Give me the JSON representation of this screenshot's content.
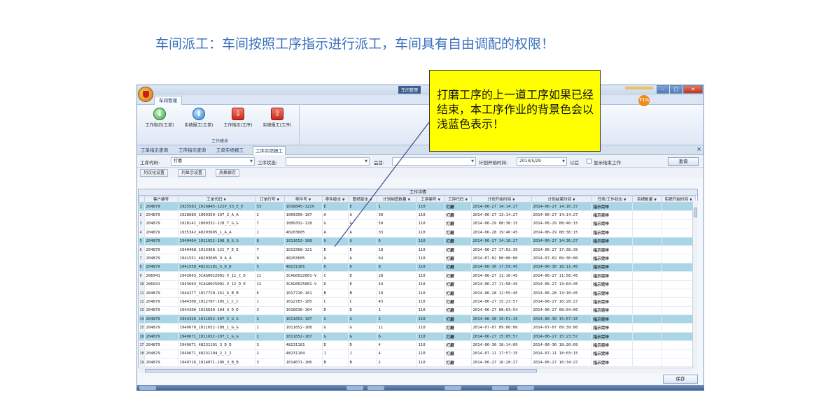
{
  "slide_title": "车间派工：车间按照工序指示进行派工，车间具有自由调配的权限！",
  "callout_text": "打磨工序的上一道工序如果已经结束，本工序作业的背景色会以浅蓝色表示！",
  "window": {
    "title": "车间管理",
    "cpu": "71%"
  },
  "ribbon": {
    "tab": "车间管理",
    "buttons": [
      "工作指示(工单)",
      "实绩报工(工单)",
      "工作指示(工序)",
      "实绩报工(工序)"
    ],
    "group_label": "工作模块"
  },
  "doc_tabs": [
    "工单指示查询",
    "工序指示查询",
    "工单实绩报工",
    "工序实绩报工"
  ],
  "filters": {
    "op_code_label": "工序代码:",
    "op_code_value": "打磨",
    "op_status_label": "工序状态:",
    "op_status_value": "",
    "item_label": "品目:",
    "item_value": "",
    "plan_start_label": "计划开始时间:",
    "plan_start_value": "2014/5/29",
    "after_label": "以后",
    "show_end_label": "显示结束工作",
    "query_button": "查询"
  },
  "toolbar": {
    "col_settings": "列汉化设置",
    "col_display": "列显示设置",
    "style_save": "风格保存"
  },
  "grid": {
    "band": "工作详情",
    "columns": [
      "客户编号",
      "工单代码",
      "订单行号",
      "零件号",
      "零件版本",
      "图纸版本",
      "计划制造数量",
      "工序编号",
      "工序代码",
      "计划开始时间",
      "计划结束时间",
      "任务/工作状态",
      "实绩数量",
      "实绩开始时间"
    ],
    "rows": [
      {
        "n": "1",
        "c": [
          "204879",
          "1925583_1016845-122V_53_E_E",
          "53",
          "1016845-122V",
          "E",
          "E",
          "1",
          "110",
          "打磨",
          "2014-06-27 14:14:27",
          "2014-06-27 14:16:27",
          "指示完毕",
          "",
          ""
        ],
        "hl": true
      },
      {
        "n": "2",
        "c": [
          "204879",
          "1928089_1009350-107_2_A_A",
          "2",
          "1009350-107",
          "A",
          "A",
          "30",
          "110",
          "打磨",
          "2014-06-27 13:14:27",
          "2014-06-27 14:14:27",
          "指示完毕",
          "",
          ""
        ],
        "hl": false
      },
      {
        "n": "3",
        "c": [
          "204879",
          "1928141_1009332-128_7_G_G",
          "7",
          "1009332-128",
          "G",
          "G",
          "50",
          "110",
          "打磨",
          "2014-06-29 08:36:15",
          "2014-06-29 08:46:15",
          "指示完毕",
          "",
          ""
        ],
        "hl": false
      },
      {
        "n": "4",
        "c": [
          "204879",
          "1935342_48203605_1_A_A",
          "1",
          "48203605",
          "A",
          "A",
          "33",
          "110",
          "打磨",
          "2014-06-28 19:46:45",
          "2014-06-29 08:36:15",
          "指示完毕",
          "",
          ""
        ],
        "hl": false
      },
      {
        "n": "5",
        "c": [
          "204879",
          "1940464_1011652-108_8_G_G",
          "8",
          "1011652-108",
          "G",
          "G",
          "6",
          "110",
          "打磨",
          "2014-06-27 14:18:27",
          "2014-06-27 14:36:27",
          "指示完毕",
          "",
          ""
        ],
        "hl": true
      },
      {
        "n": "6",
        "c": [
          "204879",
          "1940468_1013368-121_7_E_E",
          "7",
          "1013368-121",
          "E",
          "E",
          "18",
          "110",
          "打磨",
          "2014-06-27 17:02:39",
          "2014-06-27 17:38:39",
          "指示完毕",
          "",
          ""
        ],
        "hl": false
      },
      {
        "n": "7",
        "c": [
          "204879",
          "1941551_48203605_9_A_A",
          "9",
          "48203605",
          "A",
          "A",
          "64",
          "110",
          "打磨",
          "2014-07-02 08:00:00",
          "2014-07-02 09:36:00",
          "指示完毕",
          "",
          ""
        ],
        "hl": false
      },
      {
        "n": "8",
        "c": [
          "204879",
          "1941558_48231101_5_D_D",
          "5",
          "48231101",
          "D",
          "D",
          "8",
          "110",
          "打磨",
          "2014-06-30 17:59:45",
          "2014-06-30 18:11:45",
          "指示完毕",
          "",
          ""
        ],
        "hl": true
      },
      {
        "n": "9",
        "c": [
          "206941",
          "1943663_3CAG0022001-V_11_C_D",
          "11",
          "3CAG0022001-V",
          "C",
          "D",
          "28",
          "110",
          "打磨",
          "2014-06-27 11:16:45",
          "2014-06-27 11:58:45",
          "指示完毕",
          "",
          ""
        ],
        "hl": false
      },
      {
        "n": "10",
        "c": [
          "206941",
          "1943663_3CAG0025001-V_12_D_E",
          "12",
          "3CAG0025001-V",
          "D",
          "E",
          "44",
          "110",
          "打磨",
          "2014-06-27 11:58:45",
          "2014-06-27 13:04:45",
          "指示完毕",
          "",
          ""
        ],
        "hl": false
      },
      {
        "n": "11",
        "c": [
          "204879",
          "1944277_1017720-161_6_B_B",
          "6",
          "1017720-161",
          "B",
          "B",
          "10",
          "110",
          "打磨",
          "2014-06-28 12:55:45",
          "2014-06-28 13:10:45",
          "指示完毕",
          "",
          ""
        ],
        "hl": false
      },
      {
        "n": "12",
        "c": [
          "204879",
          "1944300_1012787-105_1_C_C",
          "1",
          "1012787-105",
          "C",
          "C",
          "43",
          "110",
          "打磨",
          "2014-06-27 15:23:57",
          "2014-06-27 16:28:27",
          "指示完毕",
          "",
          ""
        ],
        "hl": false
      },
      {
        "n": "13",
        "c": [
          "204879",
          "1944300_1016630-104_3_D_D",
          "3",
          "1016630-104",
          "D",
          "D",
          "1",
          "110",
          "打磨",
          "2014-06-27 08:03:54",
          "2014-06-27 08:04:06",
          "指示完毕",
          "",
          ""
        ],
        "hl": false
      },
      {
        "n": "14",
        "c": [
          "204879",
          "1944326_1011652-107_2_G_G",
          "2",
          "1011652-107",
          "G",
          "G",
          "2",
          "110",
          "打磨",
          "2014-06-30 15:51:15",
          "2014-06-30 15:57:15",
          "指示完毕",
          "",
          ""
        ],
        "hl": true
      },
      {
        "n": "15",
        "c": [
          "204879",
          "1949670_1011652-108_1_G_G",
          "1",
          "1011652-108",
          "G",
          "G",
          "11",
          "110",
          "打磨",
          "2014-07-07 09:06:00",
          "2014-07-07 09:39:00",
          "指示完毕",
          "",
          ""
        ],
        "hl": false
      },
      {
        "n": "16",
        "c": [
          "204879",
          "1949671_1011652-107_1_G_G",
          "1",
          "1011652-107",
          "G",
          "G",
          "6",
          "110",
          "打磨",
          "2014-06-27 15:05:57",
          "2014-06-27 15:23:57",
          "指示完毕",
          "",
          ""
        ],
        "hl": true
      },
      {
        "n": "17",
        "c": [
          "204879",
          "1949671_48231101_3_D_D",
          "3",
          "48231101",
          "D",
          "D",
          "4",
          "110",
          "打磨",
          "2014-06-30 18:14:09",
          "2014-06-30 18:20:09",
          "指示完毕",
          "",
          ""
        ],
        "hl": false
      },
      {
        "n": "18",
        "c": [
          "204879",
          "1949671_48231104_2_J_J",
          "2",
          "48231104",
          "J",
          "J",
          "4",
          "110",
          "打磨",
          "2014-07-11 17:57:15",
          "2014-07-11 18:03:15",
          "指示完毕",
          "",
          ""
        ],
        "hl": false
      },
      {
        "n": "19",
        "c": [
          "204879",
          "1949716_1014071-106_3_B_B",
          "3",
          "1014071-106",
          "B",
          "B",
          "2",
          "110",
          "打磨",
          "2014-06-27 16:28:27",
          "2014-06-27 16:34:27",
          "指示完毕",
          "",
          ""
        ],
        "hl": false
      }
    ]
  },
  "save_button": "保存",
  "colors": {
    "highlight_row": "#a9d6e6",
    "callout_bg": "#ffff00",
    "title_color": "#3b6fbf"
  }
}
